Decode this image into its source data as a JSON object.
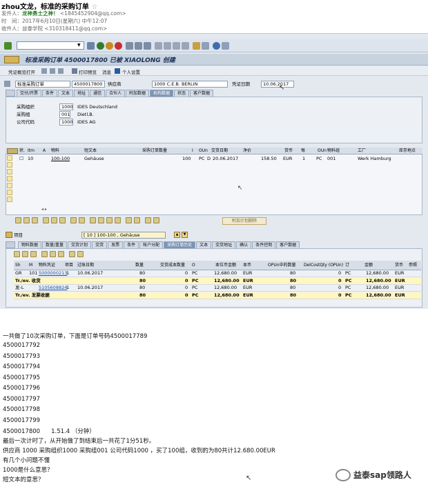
{
  "email": {
    "subject": "zhou文龙，标准的采购订单",
    "star": "☆",
    "from_label": "发件人：",
    "from_name": "龙神勇士之神！",
    "from_addr": "<1845452904@qq.com>",
    "time_label": "时　间：",
    "time_value": "2017年6月10日(星期六) 中午12:07",
    "to_label": "收件人：",
    "to_value": "益泰学院 <310318411@qq.com>"
  },
  "sap": {
    "title": "标准采购订单 4500017800 已被 XIAOLONG 创建",
    "app_buttons": [
      "凭证概览打开",
      "打印预览",
      "消息",
      "个人设置"
    ],
    "doc_type": "标准采购订单",
    "po_number": "4500017800",
    "vendor_label": "供应商",
    "vendor_value": "1000 C.E.B. BERLIN",
    "doc_date_label": "凭证日期",
    "doc_date_value": "10.06.2017",
    "header_tabs": [
      "交付/开票",
      "条件",
      "文本",
      "地址",
      "通信",
      "合伙人",
      "附加数据",
      "机构数据",
      "状态",
      "客户数据"
    ],
    "header_active_tab": "机构数据",
    "org": [
      {
        "label": "采购组织",
        "code": "1000",
        "desc": "IDES Deutschland"
      },
      {
        "label": "采购组",
        "code": "001",
        "desc": "Dietl,B."
      },
      {
        "label": "公司代码",
        "code": "1000",
        "desc": "IDES AG"
      }
    ],
    "items_columns": [
      "状.",
      "Itm",
      "A",
      "物料",
      "短文本",
      "采购订单数量",
      "I",
      "OUn",
      "交货日期",
      "净价",
      "货币",
      "每",
      "OUn",
      "物料组",
      "工厂",
      "库存地点"
    ],
    "items_row": {
      "status": "☐",
      "itm": "10",
      "material": "100-100",
      "short_text": "Gehäuse",
      "qty": "100",
      "oun": "PC",
      "d": "D",
      "delivery": "20.06.2017",
      "net_price": "158.50",
      "currency": "EUR",
      "per": "1",
      "oun2": "PC",
      "mat_group": "001",
      "plant": "Werk Hamburg"
    },
    "add_plan_btn": "附加计划删除",
    "item_label": "项目",
    "item_select": "[ 10 ] 100-100 , Gehäuse",
    "item_tabs": [
      "物料数据",
      "数量/重量",
      "交货计划",
      "交货",
      "发票",
      "条件",
      "帐户分配",
      "采购订单历史",
      "文本",
      "交货地址",
      "确认",
      "条件控制",
      "客户数据"
    ],
    "item_active_tab": "采购订单历史",
    "hist_columns": [
      "Sh",
      "M",
      "物料凭证",
      "项目",
      "过账日期",
      "数量",
      "交货成本数量",
      "O",
      "本位币金额",
      "本币",
      "OPUn中的数量",
      "DelCostQty (OPUn)",
      "订",
      "金额",
      "货币",
      "参照"
    ],
    "hist_rows": [
      {
        "sh": "GR",
        "m": "101",
        "doc": "5000000213",
        "item": "1",
        "date": "10.06.2017",
        "qty": "80",
        "cost": "0",
        "o": "PC",
        "lc_amt": "12,680.00",
        "lc": "EUR",
        "opun": "80",
        "delcost": "0",
        "ord": "PC",
        "amt": "12,680.00",
        "cur": "EUR",
        "ref": "",
        "yellow": false
      },
      {
        "sh": "Tr./ev. 收货",
        "m": "",
        "doc": "",
        "item": "",
        "date": "",
        "qty": "80",
        "cost": "0",
        "o": "PC",
        "lc_amt": "12,680.00",
        "lc": "EUR",
        "opun": "80",
        "delcost": "0",
        "ord": "PC",
        "amt": "12,680.00",
        "cur": "EUR",
        "ref": "",
        "yellow": true
      },
      {
        "sh": "发-L",
        "m": "",
        "doc": "5105608824",
        "item": "1",
        "date": "10.06.2017",
        "qty": "80",
        "cost": "0",
        "o": "PC",
        "lc_amt": "12,680.00",
        "lc": "EUR",
        "opun": "80",
        "delcost": "0",
        "ord": "PC",
        "amt": "12,680.00",
        "cur": "EUR",
        "ref": "",
        "yellow": false
      },
      {
        "sh": "Tr./ev. 发票收据",
        "m": "",
        "doc": "",
        "item": "",
        "date": "",
        "qty": "80",
        "cost": "0",
        "o": "PC",
        "lc_amt": "12,680.00",
        "lc": "EUR",
        "opun": "80",
        "delcost": "0",
        "ord": "PC",
        "amt": "12,680.00",
        "cur": "EUR",
        "ref": "",
        "yellow": true
      }
    ]
  },
  "notes": {
    "intro": "一共做了10次采购订单，下面是订单号码4500017789",
    "orders": [
      "4500017792",
      "4500017793",
      "4500017794",
      "4500017795",
      "4500017796",
      "4500017797",
      "4500017798",
      "4500017799"
    ],
    "last_order": "4500017800",
    "last_time": "1.51.4 （分钟）",
    "line1": "最后一次计时了，从开始做了到结束后一共花了1分51秒。",
    "line2": "供应商 1000 采购组织1000 采购组001 公司代码1000 ，买了100组，收到的为80共计12.680.00EUR",
    "line3": "有几个小问题不懂",
    "line4": "1000是什么意思？",
    "line5": "短文本的意思？"
  },
  "watermark": "益泰sap领路人"
}
